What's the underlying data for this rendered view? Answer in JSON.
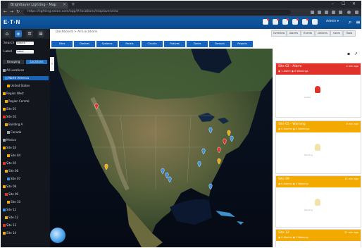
{
  "browser": {
    "tab_title": "Brightlayer Lighting - Map",
    "url": "https://lighting.eaton.com/app/#/locations/map/overview",
    "new_tab": "+",
    "window_controls": [
      "–",
      "☐",
      "✕"
    ]
  },
  "app": {
    "logo": "E·T·N",
    "user_label": "Admin ▾",
    "header_icons": [
      "alarm-icon",
      "event-icon",
      "device-icon",
      "report-icon",
      "settings-icon",
      "help-icon"
    ]
  },
  "left_panel": {
    "search_label": "Search",
    "search_value": "Search",
    "filter_label": "Label",
    "filter_value": "Label",
    "buttons": [
      "Grouping",
      "Locations"
    ],
    "tree": [
      {
        "label": "All Locations",
        "color": "#9aa3ad"
      },
      {
        "label": "North America",
        "color": "#3b8fe0",
        "selected": true
      },
      {
        "label": "United States",
        "color": "#f2a900"
      },
      {
        "label": "Region West",
        "color": "#f2a900"
      },
      {
        "label": "Region Central",
        "color": "#f2a900"
      },
      {
        "label": "Site 01",
        "color": "#f2a900"
      },
      {
        "label": "Site 02",
        "color": "#e0322b"
      },
      {
        "label": "Building A",
        "color": "#f2a900"
      },
      {
        "label": "Canada",
        "color": "#9aa3ad"
      },
      {
        "label": "Mexico",
        "color": "#9aa3ad"
      },
      {
        "label": "Site 03",
        "color": "#f2a900"
      },
      {
        "label": "Site 04",
        "color": "#f2a900"
      },
      {
        "label": "Site 05",
        "color": "#e0322b"
      },
      {
        "label": "Site 06",
        "color": "#f2a900"
      },
      {
        "label": "Site 07",
        "color": "#3b8fe0"
      },
      {
        "label": "Site 08",
        "color": "#f2a900"
      },
      {
        "label": "Site 09",
        "color": "#e0322b"
      },
      {
        "label": "Site 10",
        "color": "#f2a900"
      },
      {
        "label": "Site 11",
        "color": "#3b8fe0"
      },
      {
        "label": "Site 12",
        "color": "#f2a900"
      },
      {
        "label": "Site 13",
        "color": "#e0322b"
      },
      {
        "label": "Site 14",
        "color": "#f2a900"
      }
    ]
  },
  "toolbar": {
    "breadcrumb": "Dashboard > All Locations",
    "view_tabs": [
      "Overview",
      "Alarms",
      "Events",
      "Devices",
      "Users",
      "Tools"
    ],
    "map_buttons": [
      "Sites",
      "Devices",
      "Systems",
      "Panels",
      "Circuits",
      "Fixtures",
      "Zones",
      "Sensors",
      "Reports"
    ]
  },
  "map": {
    "status_colors": {
      "alarm": "#e0322b",
      "warning": "#f2a900",
      "normal": "#3b8fe0"
    },
    "pins": [
      {
        "status": "alarm"
      },
      {
        "status": "warning"
      },
      {
        "status": "normal"
      },
      {
        "status": "normal"
      },
      {
        "status": "normal"
      },
      {
        "status": "alarm"
      },
      {
        "status": "alarm"
      },
      {
        "status": "warning"
      },
      {
        "status": "normal"
      },
      {
        "status": "normal"
      },
      {
        "status": "warning"
      },
      {
        "status": "normal"
      },
      {
        "status": "normal"
      },
      {
        "status": "normal"
      }
    ],
    "collapse_label": "‹"
  },
  "right_panel": {
    "cards": [
      {
        "title": "Site 02 - Alarm",
        "time": "2 min ago",
        "meta": "◉ 1 Alarm  ◉ 0 Warnings",
        "color": "#e0322b",
        "status_note": "Active"
      },
      {
        "title": "Site 05 - Warning",
        "time": "8 min ago",
        "meta": "◉ 0 Alarms  ◉ 2 Warnings",
        "color": "#f2a900",
        "status_note": "Pending"
      },
      {
        "title": "Site 09",
        "time": "15 min ago",
        "meta": "◉ 0 Alarms  ◉ 1 Warning",
        "color": "#f2a900",
        "status_note": "Pending"
      },
      {
        "title": "Site 12",
        "time": "22 min ago",
        "meta": "◉ 0 Alarms  ◉ 1 Warning",
        "color": "#f2a900",
        "status_note": ""
      }
    ]
  }
}
